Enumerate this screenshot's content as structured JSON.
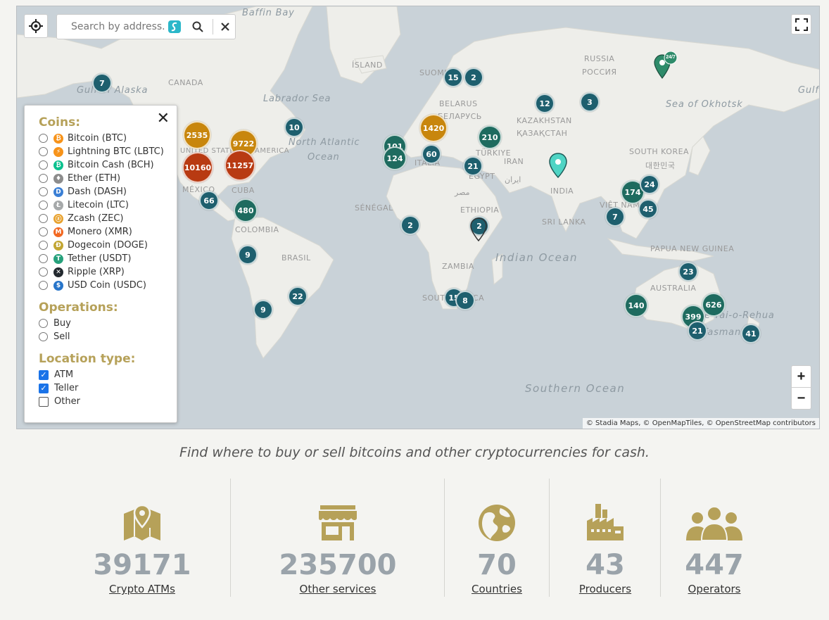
{
  "map": {
    "search_placeholder": "Search by address...",
    "attribution": "© Stadia Maps, © OpenMapTiles, © OpenStreetMap contributors",
    "zoom_in": "+",
    "zoom_out": "−",
    "labels": {
      "baffin_bay": "Baffin Bay",
      "canada": "CANADA",
      "gulf_alaska": "Gulf of Alaska",
      "labrador": "Labrador Sea",
      "north_atlantic": "North Atlantic",
      "ocean": "Ocean",
      "mexico": "MÉXICO",
      "cuba": "CUBA",
      "colombia": "COLOMBIA",
      "brasil": "BRASIL",
      "island": "ÍSLAND",
      "suomi": "SUOMI",
      "belarus": "BELARUS",
      "belarus_cyr": "БЕЛАРУСЬ",
      "kazakhstan": "KAZAKHSTAN",
      "kazakhstan_cyr": "ҚАЗАҚСТАН",
      "russia": "RUSSIA",
      "russia_cyr": "РОССИЯ",
      "okhotsk": "Sea of Okhotsk",
      "turkiye": "TÜRKIYE",
      "iran": "IRAN",
      "iran_fa": "ایران",
      "egypt": "EGYPT",
      "egypt_ar": "مصر",
      "india": "INDIA",
      "south_korea": "SOUTH KOREA",
      "south_korea_ko": "대한민국",
      "senegal": "SÉNÉGAL",
      "ethiopia": "ETHIOPIA",
      "sri_lanka": "SRI LANKA",
      "viet_nam": "VIỆT NAM",
      "png": "PAPUA NEW GUINEA",
      "indian_ocean": "Indian Ocean",
      "zambia": "ZAMBIA",
      "south_africa": "SOUTH AFRICA",
      "australia": "AUSTRALIA",
      "tasman": "Tasman",
      "rehua": "Te Tai-o-Rehua",
      "southern_ocean": "Southern Ocean",
      "italia": "ITALIA",
      "gulf_right": "Gulf",
      "united_states": "UNITED STATES OF AMERICA"
    },
    "clusters": [
      {
        "id": "alaska",
        "value": "7"
      },
      {
        "id": "us-west",
        "value": "2535"
      },
      {
        "id": "us-east",
        "value": "9722"
      },
      {
        "id": "us-south",
        "value": "10160"
      },
      {
        "id": "us-florida",
        "value": "11257"
      },
      {
        "id": "newfoundland",
        "value": "10"
      },
      {
        "id": "central-am",
        "value": "66"
      },
      {
        "id": "caribbean",
        "value": "480"
      },
      {
        "id": "peru",
        "value": "9"
      },
      {
        "id": "argentina-n",
        "value": "22"
      },
      {
        "id": "chile",
        "value": "9"
      },
      {
        "id": "scandinavia",
        "value": "15"
      },
      {
        "id": "finland",
        "value": "2"
      },
      {
        "id": "europe-west",
        "value": "101"
      },
      {
        "id": "spain",
        "value": "124"
      },
      {
        "id": "europe-central",
        "value": "1420"
      },
      {
        "id": "italy",
        "value": "60"
      },
      {
        "id": "turkey",
        "value": "210"
      },
      {
        "id": "russia-west",
        "value": "12"
      },
      {
        "id": "russia-central",
        "value": "3"
      },
      {
        "id": "middle-east",
        "value": "21"
      },
      {
        "id": "west-africa",
        "value": "2"
      },
      {
        "id": "east-africa",
        "value": "2"
      },
      {
        "id": "south-africa-w",
        "value": "15"
      },
      {
        "id": "south-africa-e",
        "value": "8"
      },
      {
        "id": "china-south",
        "value": "174"
      },
      {
        "id": "korea",
        "value": "24"
      },
      {
        "id": "philippines",
        "value": "45"
      },
      {
        "id": "thailand",
        "value": "7"
      },
      {
        "id": "australia-n",
        "value": "23"
      },
      {
        "id": "australia-w",
        "value": "140"
      },
      {
        "id": "australia-e",
        "value": "626"
      },
      {
        "id": "australia-se",
        "value": "399"
      },
      {
        "id": "tasmania",
        "value": "21"
      },
      {
        "id": "new-zealand",
        "value": "41"
      }
    ],
    "pins": {
      "tag_247": "24/7"
    }
  },
  "filters": {
    "close": "✕",
    "coins_title": "Coins:",
    "coins": [
      {
        "label": "Bitcoin (BTC)",
        "symbol": "₿",
        "color": "#f7931a"
      },
      {
        "label": "Lightning BTC (LBTC)",
        "symbol": "⚡",
        "color": "#f7931a"
      },
      {
        "label": "Bitcoin Cash (BCH)",
        "symbol": "₿",
        "color": "#0ac18e"
      },
      {
        "label": "Ether (ETH)",
        "symbol": "♦",
        "color": "#8c8c8c"
      },
      {
        "label": "Dash (DASH)",
        "symbol": "D",
        "color": "#3a7fd5"
      },
      {
        "label": "Litecoin (LTC)",
        "symbol": "Ł",
        "color": "#a6a9aa"
      },
      {
        "label": "Zcash (ZEC)",
        "symbol": "ⓩ",
        "color": "#e8a22e"
      },
      {
        "label": "Monero (XMR)",
        "symbol": "M",
        "color": "#f26822"
      },
      {
        "label": "Dogecoin (DOGE)",
        "symbol": "Ð",
        "color": "#c2a633"
      },
      {
        "label": "Tether (USDT)",
        "symbol": "T",
        "color": "#26a17b"
      },
      {
        "label": "Ripple (XRP)",
        "symbol": "✕",
        "color": "#23292f"
      },
      {
        "label": "USD Coin (USDC)",
        "symbol": "$",
        "color": "#2775ca"
      }
    ],
    "operations_title": "Operations:",
    "operations": [
      "Buy",
      "Sell"
    ],
    "location_title": "Location type:",
    "locations": [
      {
        "label": "ATM",
        "checked": true
      },
      {
        "label": "Teller",
        "checked": true
      },
      {
        "label": "Other",
        "checked": false
      }
    ]
  },
  "tagline": "Find where to buy or sell bitcoins and other cryptocurrencies for cash.",
  "stats": [
    {
      "value": "39171",
      "label": "Crypto ATMs",
      "icon": "map-pin-icon"
    },
    {
      "value": "235700",
      "label": "Other services",
      "icon": "storefront-icon"
    },
    {
      "value": "70",
      "label": "Countries",
      "icon": "globe-icon"
    },
    {
      "value": "43",
      "label": "Producers",
      "icon": "factory-icon"
    },
    {
      "value": "447",
      "label": "Operators",
      "icon": "people-icon"
    }
  ],
  "colors": {
    "accent_gold": "#b6a159",
    "stat_number": "#9aa3aa",
    "cluster_teal": "#1e5f6e",
    "cluster_orange": "#c8860d",
    "cluster_red": "#b83a12"
  }
}
